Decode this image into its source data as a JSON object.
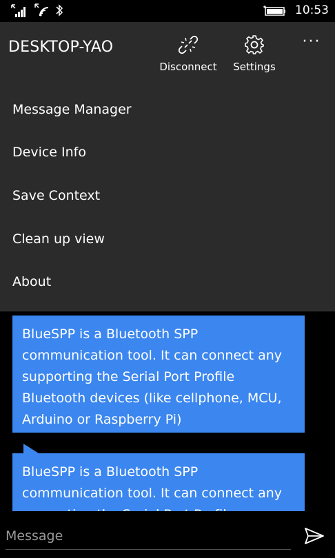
{
  "status_bar": {
    "time": "10:53",
    "icons": [
      "signal-icon",
      "wifi-icon",
      "bluetooth-icon",
      "battery-icon"
    ]
  },
  "app_bar": {
    "title": "DESKTOP-YAO",
    "disconnect_label": "Disconnect",
    "settings_label": "Settings",
    "more_label": "···"
  },
  "menu": {
    "items": [
      {
        "label": "Message Manager"
      },
      {
        "label": "Device Info"
      },
      {
        "label": "Save Context"
      },
      {
        "label": "Clean up view"
      },
      {
        "label": "About"
      }
    ]
  },
  "chat": {
    "messages": [
      {
        "text": "BlueSPP is a Bluetooth SPP communication tool. It can connect any supporting the Serial Port Profile Bluetooth devices (like cellphone, MCU, Arduino or Raspberry Pi)"
      },
      {
        "text": "BlueSPP is a Bluetooth SPP communication tool. It can connect any supporting the Serial Port Profile Bluetooth devices (like cellphone, MCU, Arduino or Raspberry Pi)"
      }
    ]
  },
  "input": {
    "placeholder": "Message",
    "value": ""
  },
  "colors": {
    "app_bar_bg": "#2b2b2b",
    "bubble_bg": "#3b86ef",
    "background": "#000000"
  }
}
